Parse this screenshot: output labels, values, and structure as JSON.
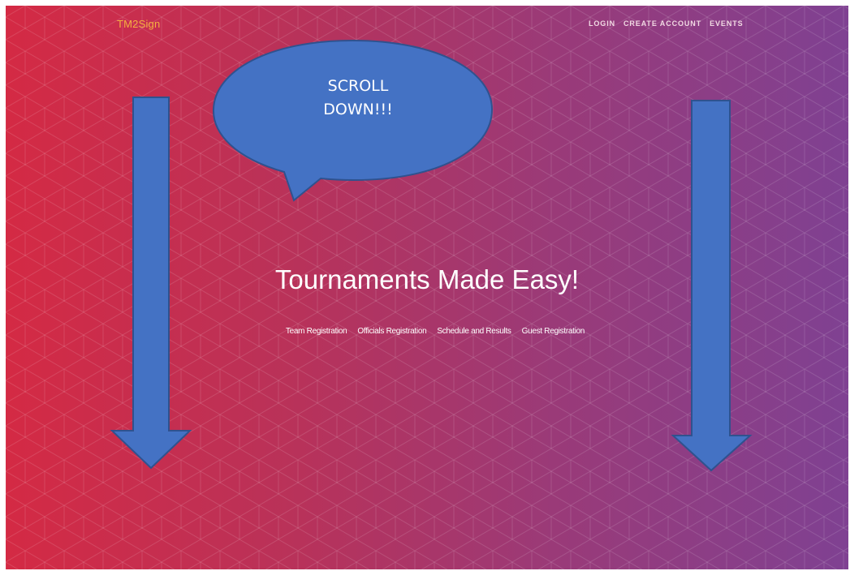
{
  "header": {
    "brand": "TM2Sign",
    "nav": [
      {
        "label": "LOGIN"
      },
      {
        "label": "CREATE ACCOUNT"
      },
      {
        "label": "EVENTS"
      }
    ]
  },
  "hero": {
    "title": "Tournaments Made Easy!",
    "links": [
      {
        "label": "Team Registration"
      },
      {
        "label": "Officials Registration"
      },
      {
        "label": "Schedule and Results"
      },
      {
        "label": "Guest Registration"
      }
    ]
  },
  "annotation": {
    "callout_text": "SCROLL\nDOWN!!!",
    "arrow_left_icon": "arrow-down-icon",
    "arrow_right_icon": "arrow-down-icon"
  },
  "colors": {
    "gradient_start": "#d42a44",
    "gradient_end": "#7f4192",
    "brand": "#f5b041",
    "callout_fill": "#4472c4",
    "callout_stroke": "#2f528f"
  }
}
